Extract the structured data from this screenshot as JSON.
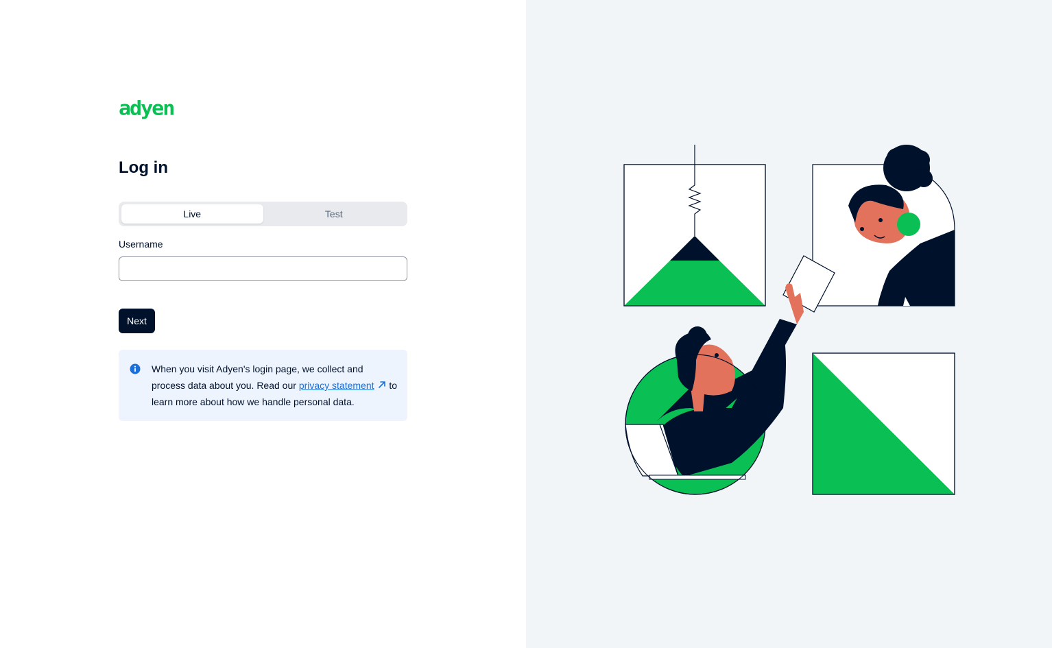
{
  "brand": {
    "logo_text": "adyen",
    "color": "#0abf53"
  },
  "login": {
    "title": "Log in",
    "environment_tabs": [
      {
        "label": "Live",
        "active": true
      },
      {
        "label": "Test",
        "active": false
      }
    ],
    "username_label": "Username",
    "username_value": "",
    "username_placeholder": "",
    "next_label": "Next"
  },
  "notice": {
    "icon": "info-icon",
    "text_before": "When you visit Adyen's login page, we collect and process data about you. Read our ",
    "link_text": "privacy statement",
    "text_after": " to learn more about how we handle personal data."
  },
  "colors": {
    "primary_dark": "#00112c",
    "accent_green": "#0abf53",
    "link_blue": "#1b6fd8",
    "right_panel_bg": "#f2f5f8",
    "notice_bg": "#eef4fd",
    "skin_tone": "#e2725b"
  }
}
